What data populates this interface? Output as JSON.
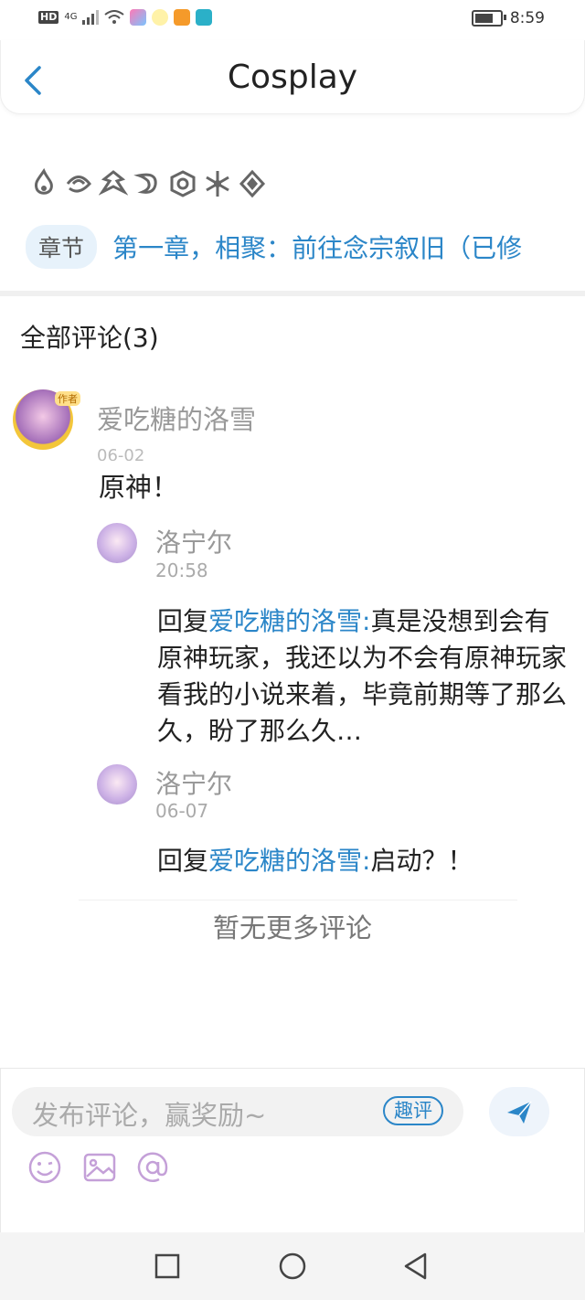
{
  "status_bar": {
    "network": "HD",
    "signal": "4G",
    "time": "8:59"
  },
  "header": {
    "title": "Cosplay"
  },
  "chapter": {
    "tag": "章节",
    "title": "第一章，相聚：前往念宗叙旧（已修"
  },
  "comments_section": {
    "heading": "全部评论(3)",
    "main_comment": {
      "user": "爱吃糖的洛雪",
      "author_badge": "作者",
      "date": "06-02",
      "text": "原神！"
    },
    "replies": [
      {
        "user": "洛宁尔",
        "time": "20:58",
        "reply_prefix": "回复",
        "reply_to": "爱吃糖的洛雪:",
        "text": "真是没想到会有原神玩家，我还以为不会有原神玩家看我的小说来着，毕竟前期等了那么久，盼了那么久…"
      },
      {
        "user": "洛宁尔",
        "time": "06-07",
        "reply_prefix": "回复",
        "reply_to": "爱吃糖的洛雪:",
        "text": "启动？！"
      }
    ],
    "no_more": "暂无更多评论"
  },
  "comment_bar": {
    "placeholder": "发布评论，赢奖励~",
    "quick_comment": "趣评"
  },
  "colors": {
    "accent": "#2b86c8",
    "purple_icon": "#c4a0d8"
  }
}
